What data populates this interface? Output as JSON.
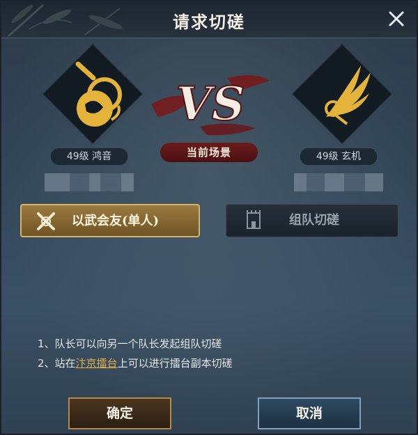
{
  "dialog": {
    "title": "请求切磋",
    "close_icon": "close-icon"
  },
  "left_player": {
    "level_label": "49级  鸿音",
    "emblem_icon": "lute-icon",
    "accent_color": "#e3b33a"
  },
  "right_player": {
    "level_label": "49级  玄机",
    "emblem_icon": "wing-icon",
    "accent_color": "#e3b33a"
  },
  "vs_label": "VS",
  "scene_label": "当前场景",
  "modes": {
    "solo_label": "以武会友(单人)",
    "team_label": "组队切磋"
  },
  "notes": {
    "line1": "1、队长可以向另一个队长发起组队切磋",
    "line2_prefix": "2、站在",
    "line2_link": "汴京擂台",
    "line2_suffix": "上可以进行擂台副本切磋"
  },
  "buttons": {
    "confirm": "确定",
    "cancel": "取消"
  }
}
